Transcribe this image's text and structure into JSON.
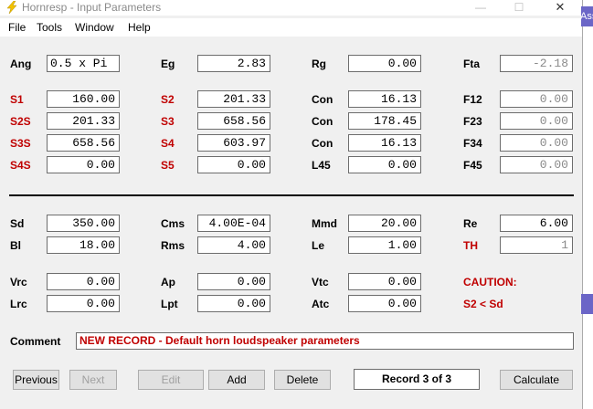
{
  "window": {
    "title": "Hornresp - Input Parameters",
    "minimize": "—",
    "maximize": "☐",
    "close": "✕"
  },
  "menu": {
    "file": "File",
    "tools": "Tools",
    "window": "Window",
    "help": "Help"
  },
  "top": {
    "ang_label": "Ang",
    "ang_value": "0.5 x Pi",
    "eg_label": "Eg",
    "eg_value": "2.83",
    "rg_label": "Rg",
    "rg_value": "0.00",
    "fta_label": "Fta",
    "fta_value": "-2.18"
  },
  "horn": {
    "s1_label": "S1",
    "s1_value": "160.00",
    "s2_label": "S2",
    "s2_value": "201.33",
    "con1_label": "Con",
    "con1_value": "16.13",
    "f12_label": "F12",
    "f12_value": "0.00",
    "s2s_label": "S2S",
    "s2s_value": "201.33",
    "s3_label": "S3",
    "s3_value": "658.56",
    "con2_label": "Con",
    "con2_value": "178.45",
    "f23_label": "F23",
    "f23_value": "0.00",
    "s3s_label": "S3S",
    "s3s_value": "658.56",
    "s4_label": "S4",
    "s4_value": "603.97",
    "con3_label": "Con",
    "con3_value": "16.13",
    "f34_label": "F34",
    "f34_value": "0.00",
    "s4s_label": "S4S",
    "s4s_value": "0.00",
    "s5_label": "S5",
    "s5_value": "0.00",
    "l45_label": "L45",
    "l45_value": "0.00",
    "f45_label": "F45",
    "f45_value": "0.00"
  },
  "driver": {
    "sd_label": "Sd",
    "sd_value": "350.00",
    "cms_label": "Cms",
    "cms_value": "4.00E-04",
    "mmd_label": "Mmd",
    "mmd_value": "20.00",
    "re_label": "Re",
    "re_value": "6.00",
    "bl_label": "Bl",
    "bl_value": "18.00",
    "rms_label": "Rms",
    "rms_value": "4.00",
    "le_label": "Le",
    "le_value": "1.00",
    "th_label": "TH",
    "th_value": "1"
  },
  "chambers": {
    "vrc_label": "Vrc",
    "vrc_value": "0.00",
    "ap_label": "Ap",
    "ap_value": "0.00",
    "vtc_label": "Vtc",
    "vtc_value": "0.00",
    "lrc_label": "Lrc",
    "lrc_value": "0.00",
    "lpt_label": "Lpt",
    "lpt_value": "0.00",
    "atc_label": "Atc",
    "atc_value": "0.00"
  },
  "caution": {
    "title": "CAUTION:",
    "message": "S2 < Sd"
  },
  "comment": {
    "label": "Comment",
    "value": "NEW RECORD - Default horn loudspeaker parameters"
  },
  "buttons": {
    "previous": "Previous",
    "next": "Next",
    "edit": "Edit",
    "add": "Add",
    "delete": "Delete",
    "record": "Record 3 of 3",
    "calculate": "Calculate"
  },
  "background_window": {
    "title_fragment": "Ass"
  },
  "colors": {
    "red_label": "#c00000",
    "accent_purple": "#6b66c7"
  }
}
